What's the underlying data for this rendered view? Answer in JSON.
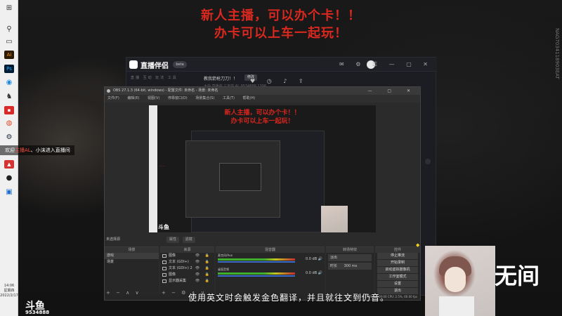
{
  "overlay": {
    "line1": "新人主播，可以办个卡！！",
    "line2": "办卡可以上车一起玩！",
    "vertical_id": "NAG7034118903EAT"
  },
  "taskbar": {
    "icons": [
      "windows-icon",
      "search-icon",
      "task-view-icon",
      "illustrator-icon",
      "photoshop-icon",
      "edge-icon",
      "qq-icon",
      "app-icon",
      "chrome-icon",
      "steam-icon",
      "douyu-icon",
      "obs-icon",
      "screenshot-icon"
    ],
    "time": "14:06",
    "day": "星期四",
    "date": "2022/2/17"
  },
  "zhibo": {
    "app_name": "直播伴侣",
    "badge": "beta",
    "tabs": "直播 互动 玩法 工具",
    "room_title": "教我箭枪刀刀！！",
    "room_btn": "修改",
    "stats": "大中 直播中  三天前  AL  9534888  1396"
  },
  "obs": {
    "title": "OBS 27.1.3 (64-bit, windows) - 配置文件: 未命名 - 场景: 未命名",
    "menu": [
      "文件(F)",
      "编辑(E)",
      "视图(V)",
      "停靠窗口(D)",
      "场景集合(S)",
      "工具(T)",
      "帮助(H)"
    ],
    "preview_line1": "新人主播，可以办个卡！！",
    "preview_line2": "办卡可以上车一起玩！",
    "preview_logo": "斗鱼",
    "no_source": "未选择源",
    "props_btn": "属性",
    "filters_btn": "滤镜",
    "docks": {
      "scenes": {
        "title": "场景",
        "items": [
          "游戏",
          "场景"
        ]
      },
      "sources": {
        "title": "来源",
        "items": [
          "图像",
          "文本 (GDI+)",
          "文本 (GDI+) 2",
          "图像",
          "显示器采集"
        ]
      },
      "mixer": {
        "title": "混音器",
        "channels": [
          {
            "name": "麦克风/Aux",
            "level": "0.0 dB"
          },
          {
            "name": "桌面音频",
            "level": "0.0 dB"
          }
        ]
      },
      "transitions": {
        "title": "转场特效",
        "type": "淡出",
        "duration_label": "时长",
        "duration": "300 ms"
      },
      "controls": {
        "title": "控件",
        "buttons": [
          "停止推流",
          "开始录制",
          "启动虚拟摄像机",
          "工作室模式",
          "设置",
          "退出"
        ]
      }
    },
    "status": "LIVE: 00:00:00   REC: 00:00:00   CPU: 2.5%, 60.00 fps"
  },
  "chat": {
    "join_prefix": "欢迎",
    "join_nick": "主播AL",
    "join_suffix": "、小沫进入直播间"
  },
  "subtitle": "使用英文时会触发金色翻译，并且就往文到仍音。",
  "watermark": {
    "logo": "斗鱼",
    "room_id": "9534888"
  },
  "calligraphy": "无间"
}
